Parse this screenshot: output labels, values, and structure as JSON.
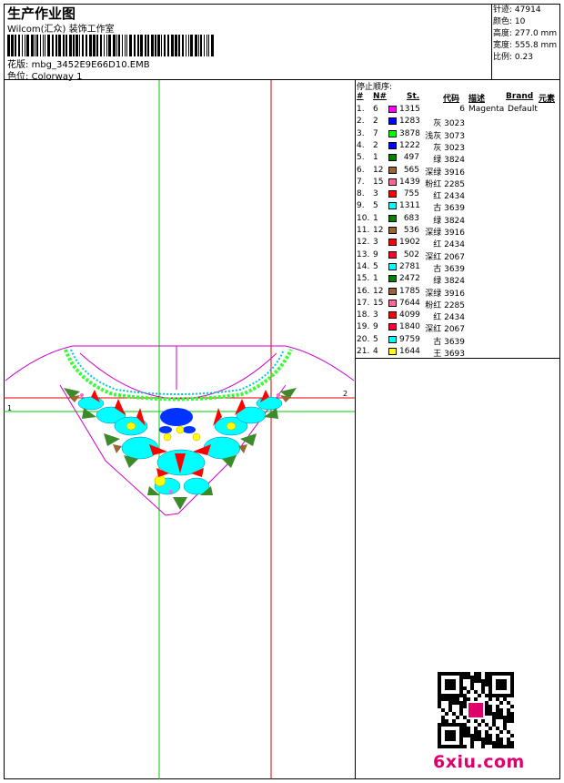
{
  "header": {
    "title": "生产作业图",
    "company": "Wilcom(汇众) 装饰工作室",
    "design_label": "花版",
    "design_value": "mbg_3452E9E66D10.EMB",
    "colorway_label": "色位",
    "colorway_value": "Colorway 1"
  },
  "stats": [
    {
      "label": "针迹",
      "value": "47914"
    },
    {
      "label": "颜色",
      "value": "10"
    },
    {
      "label": "高度",
      "value": "277.0 mm"
    },
    {
      "label": "宽度",
      "value": "555.8 mm"
    },
    {
      "label": "比例",
      "value": "0.23"
    }
  ],
  "preview": {
    "guide_1": "1",
    "guide_2": "2"
  },
  "stop_sequence": {
    "title": "停止顺序:",
    "columns": [
      "#",
      "N#",
      "St.",
      "代码",
      "描述",
      "Brand",
      "元素"
    ],
    "rows": [
      {
        "n": "1.",
        "nn": "6",
        "st": "1315",
        "color": "#ff00ff",
        "code": "6",
        "desc": "Magenta",
        "brand": "Default"
      },
      {
        "n": "2.",
        "nn": "2",
        "st": "1283",
        "color": "#0000ff",
        "code": "灰 3023",
        "desc": "",
        "brand": ""
      },
      {
        "n": "3.",
        "nn": "7",
        "st": "3878",
        "color": "#00ff00",
        "code": "浅灰 3073",
        "desc": "",
        "brand": ""
      },
      {
        "n": "4.",
        "nn": "2",
        "st": "1222",
        "color": "#0000ff",
        "code": "灰 3023",
        "desc": "",
        "brand": ""
      },
      {
        "n": "5.",
        "nn": "1",
        "st": "497",
        "color": "#008000",
        "code": "绿 3824",
        "desc": "",
        "brand": ""
      },
      {
        "n": "6.",
        "nn": "12",
        "st": "565",
        "color": "#996633",
        "code": "深绿 3916",
        "desc": "",
        "brand": ""
      },
      {
        "n": "7.",
        "nn": "15",
        "st": "1439",
        "color": "#ff6699",
        "code": "粉红 2285",
        "desc": "",
        "brand": ""
      },
      {
        "n": "8.",
        "nn": "3",
        "st": "755",
        "color": "#ff0000",
        "code": "红 2434",
        "desc": "",
        "brand": ""
      },
      {
        "n": "9.",
        "nn": "5",
        "st": "1311",
        "color": "#00ffff",
        "code": "古 3639",
        "desc": "",
        "brand": ""
      },
      {
        "n": "10.",
        "nn": "1",
        "st": "683",
        "color": "#008000",
        "code": "绿 3824",
        "desc": "",
        "brand": ""
      },
      {
        "n": "11.",
        "nn": "12",
        "st": "536",
        "color": "#996633",
        "code": "深绿 3916",
        "desc": "",
        "brand": ""
      },
      {
        "n": "12.",
        "nn": "3",
        "st": "1902",
        "color": "#ff0000",
        "code": "红 2434",
        "desc": "",
        "brand": ""
      },
      {
        "n": "13.",
        "nn": "9",
        "st": "502",
        "color": "#ff0033",
        "code": "深红 2067",
        "desc": "",
        "brand": ""
      },
      {
        "n": "14.",
        "nn": "5",
        "st": "2781",
        "color": "#00ffff",
        "code": "古 3639",
        "desc": "",
        "brand": ""
      },
      {
        "n": "15.",
        "nn": "1",
        "st": "2472",
        "color": "#008000",
        "code": "绿 3824",
        "desc": "",
        "brand": ""
      },
      {
        "n": "16.",
        "nn": "12",
        "st": "1785",
        "color": "#996633",
        "code": "深绿 3916",
        "desc": "",
        "brand": ""
      },
      {
        "n": "17.",
        "nn": "15",
        "st": "7644",
        "color": "#ff6699",
        "code": "粉红 2285",
        "desc": "",
        "brand": ""
      },
      {
        "n": "18.",
        "nn": "3",
        "st": "4099",
        "color": "#ff0000",
        "code": "红 2434",
        "desc": "",
        "brand": ""
      },
      {
        "n": "19.",
        "nn": "9",
        "st": "1840",
        "color": "#ff0033",
        "code": "深红 2067",
        "desc": "",
        "brand": ""
      },
      {
        "n": "20.",
        "nn": "5",
        "st": "9759",
        "color": "#00ffff",
        "code": "古 3639",
        "desc": "",
        "brand": ""
      },
      {
        "n": "21.",
        "nn": "4",
        "st": "1644",
        "color": "#ffff00",
        "code": "王 3693",
        "desc": "",
        "brand": ""
      }
    ]
  },
  "watermark": "6xiu.com",
  "colors": {
    "guide_green": "#00cc00",
    "guide_red": "#dd0000",
    "outline": "#cc00cc",
    "watermark": "#e0006a"
  }
}
